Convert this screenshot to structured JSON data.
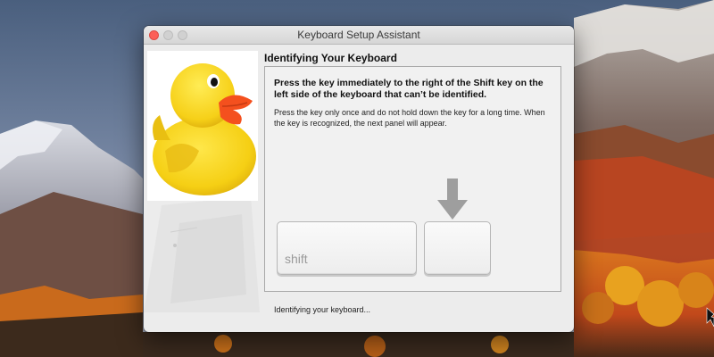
{
  "window": {
    "title": "Keyboard Setup Assistant"
  },
  "panel": {
    "heading": "Identifying Your Keyboard",
    "instruction_primary": "Press the key immediately to the right of the Shift key on the left side of the keyboard that can’t be identified.",
    "instruction_secondary": "Press the key only once and do not hold down the key for a long time. When the key is recognized, the next panel will appear.",
    "status": "Identifying your keyboard..."
  },
  "keys": {
    "shift_label": "shift"
  },
  "icons": {
    "close": "close-icon",
    "minimize": "minimize-icon",
    "zoom": "zoom-icon",
    "arrow": "arrow-down-icon",
    "illustration": "rubber-duck-image"
  },
  "colors": {
    "close_button": "#fc5f57",
    "duck_yellow": "#f5d21e",
    "duck_beak": "#f4501e",
    "window_bg": "#ececec"
  }
}
